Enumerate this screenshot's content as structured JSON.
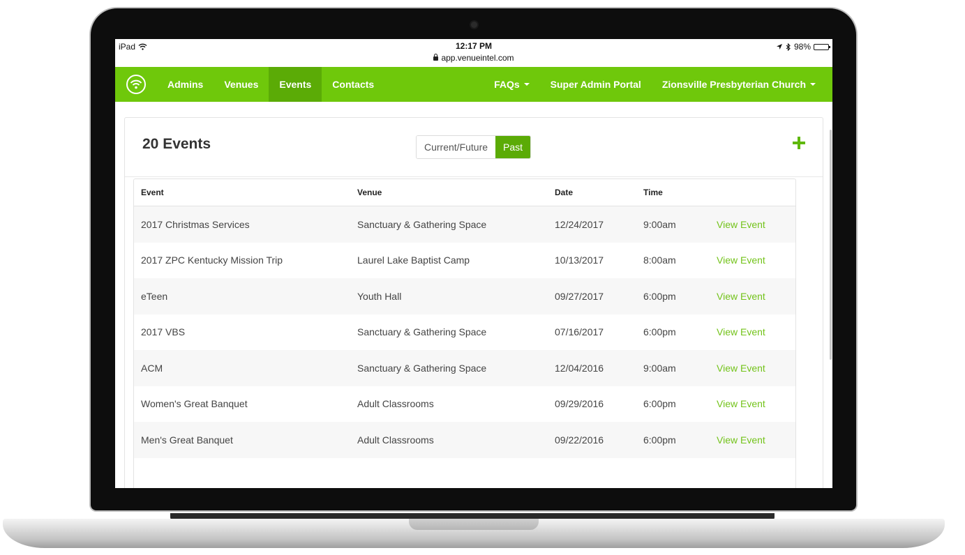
{
  "statusbar": {
    "device": "iPad",
    "time": "12:17 PM",
    "url": "app.venueintel.com",
    "battery": "98%",
    "battery_level": 0.98
  },
  "navbar": {
    "left_items": [
      "Admins",
      "Venues",
      "Events",
      "Contacts"
    ],
    "active_item": "Events",
    "faqs": "FAQs",
    "super_admin": "Super Admin Portal",
    "organization": "Zionsville Presbyterian Church"
  },
  "page": {
    "title": "20 Events",
    "toggle_current": "Current/Future",
    "toggle_past": "Past",
    "toggle_selected": "Past"
  },
  "table": {
    "headers": [
      "Event",
      "Venue",
      "Date",
      "Time"
    ],
    "action_label": "View Event",
    "rows": [
      {
        "event": "2017 Christmas Services",
        "venue": "Sanctuary & Gathering Space",
        "date": "12/24/2017",
        "time": "9:00am"
      },
      {
        "event": "2017 ZPC Kentucky Mission Trip",
        "venue": "Laurel Lake Baptist Camp",
        "date": "10/13/2017",
        "time": "8:00am"
      },
      {
        "event": "eTeen",
        "venue": "Youth Hall",
        "date": "09/27/2017",
        "time": "6:00pm"
      },
      {
        "event": "2017 VBS",
        "venue": "Sanctuary & Gathering Space",
        "date": "07/16/2017",
        "time": "6:00pm"
      },
      {
        "event": "ACM",
        "venue": "Sanctuary & Gathering Space",
        "date": "12/04/2016",
        "time": "9:00am"
      },
      {
        "event": "Women's Great Banquet",
        "venue": "Adult Classrooms",
        "date": "09/29/2016",
        "time": "6:00pm"
      },
      {
        "event": "Men's Great Banquet",
        "venue": "Adult Classrooms",
        "date": "09/22/2016",
        "time": "6:00pm"
      }
    ]
  },
  "colors": {
    "brand_green": "#6fc80b",
    "active_green": "#5bab06",
    "link_green": "#73c31a"
  }
}
